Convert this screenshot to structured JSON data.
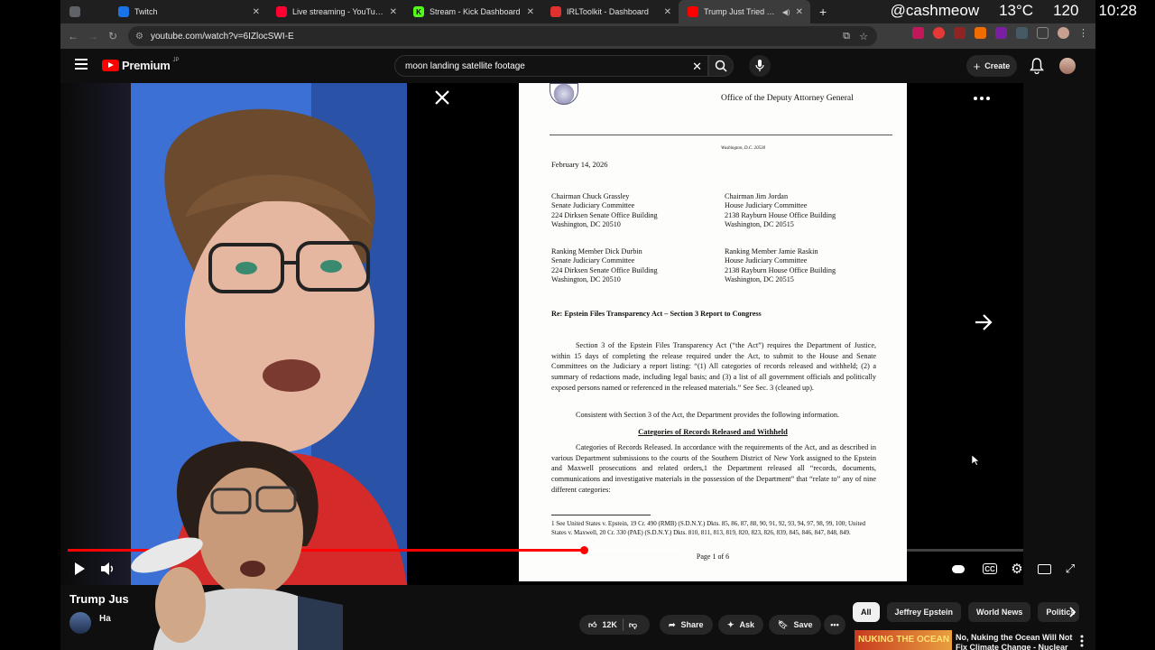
{
  "tabs": [
    {
      "title": "",
      "icon": "window-icon",
      "color": "#5f6368"
    },
    {
      "title": "Twitch",
      "icon": "twitch-icon",
      "color": "#9146ff"
    },
    {
      "title": "Live streaming - YouTube Stu",
      "icon": "youtube-studio-icon",
      "color": "#ff0033"
    },
    {
      "title": "Stream - Kick Dashboard",
      "icon": "kick-icon",
      "color": "#53fc18"
    },
    {
      "title": "IRLToolkit - Dashboard",
      "icon": "irltoolkit-icon",
      "color": "#e03030"
    },
    {
      "title": "Trump Just Tried To Cove",
      "icon": "youtube-icon",
      "color": "#ff0000"
    }
  ],
  "overlay": {
    "handle": "@cashmeow",
    "temperature": "13°C",
    "viewers": "120",
    "clock": "10:28"
  },
  "address": {
    "url": "youtube.com/watch?v=6IZlocSWI-E"
  },
  "header": {
    "logo_text": "Premium",
    "logo_region": "JP",
    "search_value": "moon landing satellite footage",
    "create_label": "Create"
  },
  "document": {
    "office": "Office of the Deputy Attorney General",
    "location": "Washington, D.C. 20530",
    "date": "February 14, 2026",
    "addressees": [
      "Chairman Chuck Grassley\nSenate Judiciary Committee\n224 Dirksen Senate Office Building\nWashington, DC 20510",
      "Chairman Jim Jordan\nHouse Judiciary Committee\n2138 Rayburn House Office Building\nWashington, DC 20515",
      "Ranking Member Dick Durbin\nSenate Judiciary Committee\n224 Dirksen Senate Office Building\nWashington, DC 20510",
      "Ranking Member Jamie Raskin\nHouse Judiciary Committee\n2138 Rayburn House Office Building\nWashington, DC 20515"
    ],
    "re_line": "Re:  Epstein Files Transparency Act – Section 3 Report to Congress",
    "para1": "Section 3 of the Epstein Files Transparency Act (“the Act”) requires the Department of Justice, within 15 days of completing the release required under the Act, to submit to the House and Senate Committees on the Judiciary a report listing: “(1) All categories of records released and withheld; (2) a summary of redactions made, including legal basis; and (3) a list of all government officials and politically exposed persons named or referenced in the released materials.” See Sec. 3 (cleaned up).",
    "para2": "Consistent with Section 3 of the Act, the Department provides the following information.",
    "section_heading": "Categories of Records Released and Withheld",
    "para3": "Categories of Records Released. In accordance with the requirements of the Act, and as described in various Department submissions to the courts of the Southern District of New York assigned to the Epstein and Maxwell prosecutions and related orders,1 the Department released all “records, documents, communications and investigative materials in the possession of the Department” that “relate to” any of nine different categories:",
    "footnote": "1  See United States v. Epstein, 19 Cr. 490 (RMB) (S.D.N.Y.) Dkts. 85, 86, 87, 88, 90, 91, 92, 93, 94, 97, 98, 99, 100; United States v. Maxwell, 20 Cr. 330 (PAE) (S.D.N.Y.) Dkts. 810, 811, 813, 819, 820, 823, 826, 839, 845, 846, 847, 848, 849.",
    "page_label": "Page 1 of 6"
  },
  "player": {
    "progress": 0.54,
    "buffered": 0.64
  },
  "video": {
    "title": "Trump Jus",
    "channel": "Ha"
  },
  "actions": {
    "likes": "12K",
    "share": "Share",
    "ask": "Ask",
    "save": "Save"
  },
  "chips": [
    "All",
    "Jeffrey Epstein",
    "World News",
    "Politics"
  ],
  "recommended": {
    "thumb_text": "NUKING THE OCEAN",
    "title": "No, Nuking the Ocean Will Not Fix Climate Change - Nuclear"
  }
}
